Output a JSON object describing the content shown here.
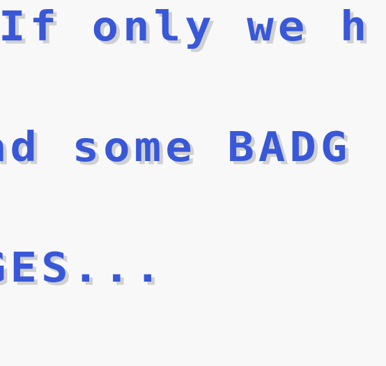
{
  "dialog": {
    "lines": [
      "If only we h",
      "ad some BADG",
      "GES..."
    ]
  },
  "colors": {
    "background": "#f8f8f8",
    "text": "#3858d8",
    "text_shadow": "#d0d0d0"
  }
}
